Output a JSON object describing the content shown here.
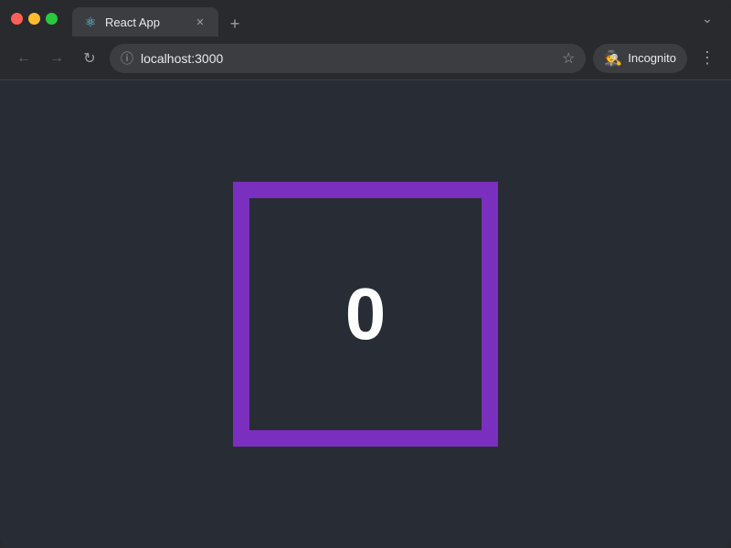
{
  "browser": {
    "tab": {
      "title": "React App",
      "favicon": "⚛"
    },
    "address": {
      "url": "localhost:3000"
    },
    "incognito": {
      "label": "Incognito"
    }
  },
  "page": {
    "counter": {
      "value": "0"
    }
  },
  "icons": {
    "back": "←",
    "forward": "→",
    "reload": "↻",
    "info": "ⓘ",
    "star": "☆",
    "close": "✕",
    "new_tab": "+",
    "menu": "⋮",
    "tab_menu": "⌄",
    "incognito": "🕵"
  }
}
